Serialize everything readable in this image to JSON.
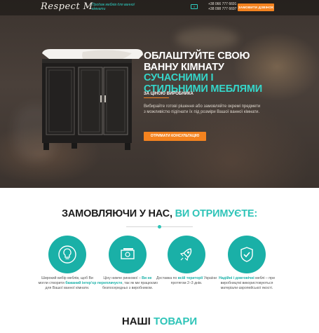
{
  "header": {
    "logo": "Respect M",
    "tagline": "Продаж меблів для ванної кімнати",
    "viber": "V",
    "phones": [
      "+38 066 777 6691",
      "+38 098 777 6697"
    ],
    "callback_label": "ЗАМОВИТИ ДЗВІНОК"
  },
  "hero": {
    "title_part1": "ОБЛАШТУЙТЕ СВОЮ ВАННУ КІМНАТУ ",
    "title_accent": "СУЧАСНИМИ І СТИЛЬНИМИ МЕБЛЯМИ",
    "subtitle": "ЗА ЦІНОЮ ВИРОБНИКА",
    "description": "Вибирайте готові рішення або замовляйте окремі предмети з можливістю підігнати їх під розміри Вашої ванної кімнати.",
    "cta_label": "ОТРИМАТИ КОНСУЛЬТАЦІЮ"
  },
  "benefits": {
    "title_part1": "ЗАМОВЛЯЮЧИ У НАС, ",
    "title_accent": "ВИ ОТРИМУЄТЕ:",
    "items": [
      {
        "icon": "lightbulb-head-icon",
        "pre": "Широкий вибір меблів, щоб Ви могли створити ",
        "highlight": "бажаний інтер'єр",
        "post": " для Вашої ванної кімнати."
      },
      {
        "icon": "banknote-icon",
        "pre": "Ціну нижче ринкової – ",
        "highlight": "Ви не переплачуєте",
        "post": ", так як ми працюємо безпосередньо з виробником."
      },
      {
        "icon": "rocket-icon",
        "pre": "Доставка по ",
        "highlight": "всій території",
        "post": " України протягом 2–3 днів."
      },
      {
        "icon": "shield-check-icon",
        "pre": "",
        "highlight": "Надійні і довговічні",
        "post": " меблі – при виробництві використовуються матеріали європейської якості."
      }
    ]
  },
  "products": {
    "title_part1": "НАШІ ",
    "title_accent": "ТОВАРИ"
  },
  "colors": {
    "accent": "#2fc4b8",
    "orange": "#f4831f"
  }
}
